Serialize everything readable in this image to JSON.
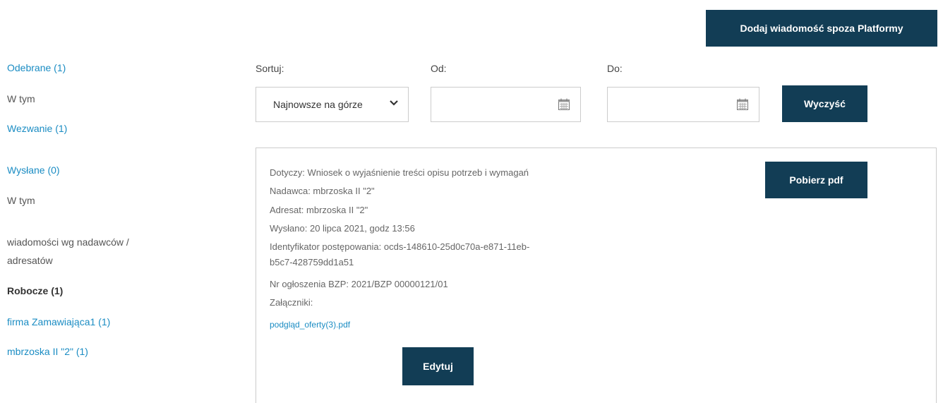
{
  "header": {
    "add_button_label": "Dodaj wiadomość spoza Platformy"
  },
  "sidebar": {
    "received": "Odebrane (1)",
    "received_subheading": "W tym",
    "summons": "Wezwanie (1)",
    "sent": "Wysłane (0)",
    "sent_subheading": "W tym",
    "by_party_line1": "wiadomości wg nadawców /",
    "by_party_line2": "adresatów",
    "drafts": "Robocze (1)",
    "party_1": "firma Zamawiająca1 (1)",
    "party_2": "mbrzoska II \"2\" (1)"
  },
  "filters": {
    "sort_label": "Sortuj:",
    "sort_value": "Najnowsze na górze",
    "from_label": "Od:",
    "from_value": "",
    "to_label": "Do:",
    "to_value": "",
    "clear_label": "Wyczyść"
  },
  "message": {
    "subject": "Dotyczy: Wniosek o wyjaśnienie treści opisu potrzeb i wymagań",
    "sender": "Nadawca: mbrzoska II \"2\"",
    "recipient": "Adresat: mbrzoska II \"2\"",
    "sent_at": "Wysłano: 20 lipca 2021, godz 13:56",
    "procedure_id_line1": "Identyfikator postępowania: ocds-148610-25d0c70a-e871-11eb-",
    "procedure_id_line2": "b5c7-428759dd1a51",
    "bzp_notice": "Nr ogłoszenia BZP: 2021/BZP 00000121/01",
    "attachments_label": "Załączniki:",
    "attachment_file": "podgląd_oferty(3).pdf",
    "download_pdf_label": "Pobierz pdf",
    "edit_label": "Edytuj"
  },
  "icons": {
    "sort_dropdown": "chevron-down-icon",
    "date_picker": "calendar-icon"
  },
  "colors": {
    "primary_button": "#123d55",
    "link": "#1a8cc3"
  }
}
